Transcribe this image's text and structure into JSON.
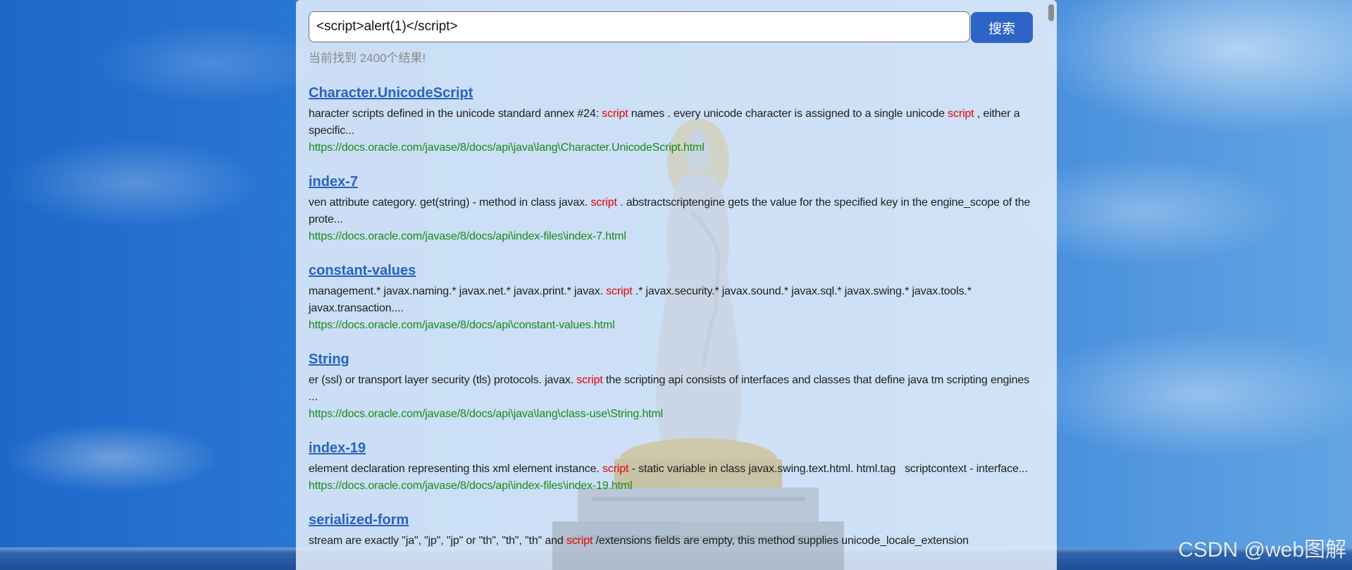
{
  "search": {
    "value": "<script>alert(1)</script>",
    "button_label": "搜索"
  },
  "result_count_text": "当前找到 2400个结果!",
  "results": [
    {
      "title": "Character.UnicodeScript",
      "description": [
        {
          "text": "haracter scripts defined in the unicode standard annex #24: ",
          "highlight": false
        },
        {
          "text": "script",
          "highlight": true
        },
        {
          "text": " names . every unicode character is assigned to a single unicode ",
          "highlight": false
        },
        {
          "text": "script",
          "highlight": true
        },
        {
          "text": " , either a specific...",
          "highlight": false
        }
      ],
      "url": "https://docs.oracle.com/javase/8/docs/api\\java\\lang\\Character.UnicodeScript.html"
    },
    {
      "title": "index-7",
      "description": [
        {
          "text": "ven attribute category. get(string) - method in class javax. ",
          "highlight": false
        },
        {
          "text": "script",
          "highlight": true
        },
        {
          "text": " . abstractscriptengine gets the value for the specified key in the engine_scope of the prote...",
          "highlight": false
        }
      ],
      "url": "https://docs.oracle.com/javase/8/docs/api\\index-files\\index-7.html"
    },
    {
      "title": "constant-values",
      "description": [
        {
          "text": "management.* javax.naming.* javax.net.* javax.print.* javax. ",
          "highlight": false
        },
        {
          "text": "script",
          "highlight": true
        },
        {
          "text": " .* javax.security.* javax.sound.* javax.sql.* javax.swing.* javax.tools.* javax.transaction....",
          "highlight": false
        }
      ],
      "url": "https://docs.oracle.com/javase/8/docs/api\\constant-values.html"
    },
    {
      "title": "String",
      "description": [
        {
          "text": "er (ssl) or transport layer security (tls) protocols. javax. ",
          "highlight": false
        },
        {
          "text": "script",
          "highlight": true
        },
        {
          "text": " the scripting api consists of interfaces and classes that define java tm scripting engines ...",
          "highlight": false
        }
      ],
      "url": "https://docs.oracle.com/javase/8/docs/api\\java\\lang\\class-use\\String.html"
    },
    {
      "title": "index-19",
      "description": [
        {
          "text": "element declaration representing this xml element instance. ",
          "highlight": false
        },
        {
          "text": "script",
          "highlight": true
        },
        {
          "text": " - static variable in class javax.swing.text.html. html.tag   scriptcontext - interface...",
          "highlight": false
        }
      ],
      "url": "https://docs.oracle.com/javase/8/docs/api\\index-files\\index-19.html"
    },
    {
      "title": "serialized-form",
      "description": [
        {
          "text": "stream are exactly \"ja\", \"jp\", \"jp\" or \"th\", \"th\", \"th\" and ",
          "highlight": false
        },
        {
          "text": "script",
          "highlight": true
        },
        {
          "text": " /extensions fields are empty, this method supplies unicode_locale_extension",
          "highlight": false
        }
      ]
    }
  ],
  "watermark": "CSDN @web图解",
  "colors": {
    "accent": "#2d64c6",
    "title": "#2a62c0",
    "highlight": "#e60000",
    "url": "#188a18",
    "muted": "#8a8a8a"
  }
}
